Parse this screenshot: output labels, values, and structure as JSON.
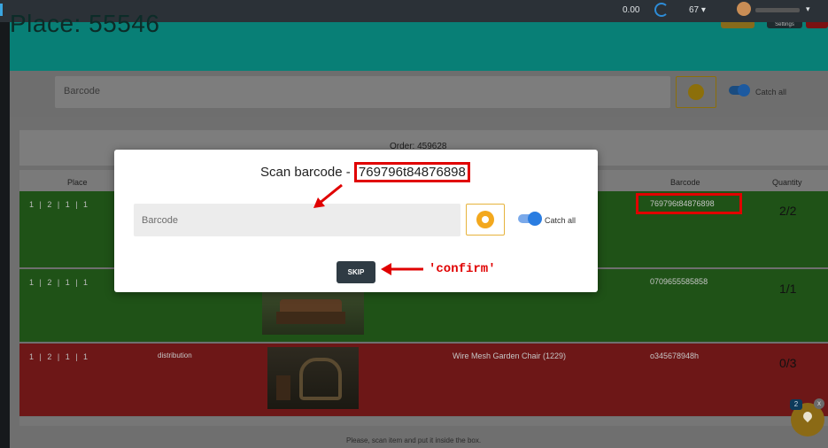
{
  "topbar": {
    "balance": "0.00",
    "count": "67 ▾",
    "user_caret": "▾"
  },
  "header": {
    "title": "Place: 55546",
    "settings_label": "Settings"
  },
  "search": {
    "placeholder": "Barcode",
    "catch_all_label": "Catch all"
  },
  "order": {
    "label": "Order: 459628"
  },
  "table": {
    "columns": {
      "place": "Place",
      "barcode": "Barcode",
      "quantity": "Quantity"
    },
    "rows": [
      {
        "place": "1 | 2 | 1 | 1",
        "type": "",
        "name": "",
        "barcode": "769796t84876898",
        "quantity": "2/2",
        "status_color": "#2e8b25"
      },
      {
        "place": "1 | 2 | 1 | 1",
        "type": "",
        "name": "",
        "barcode": "0709655585858",
        "quantity": "1/1",
        "status_color": "#2e8b25"
      },
      {
        "place": "1 | 2 | 1 | 1",
        "type": "distribution",
        "name": "Wire Mesh Garden Chair (1229)",
        "barcode": "o345678948h",
        "quantity": "0/3",
        "status_color": "#c03030"
      }
    ]
  },
  "footer": {
    "hint": "Please, scan item and put it inside the box."
  },
  "fab": {
    "badge": "2",
    "close": "x"
  },
  "modal": {
    "title_prefix": "Scan barcode - ",
    "barcode": "769796t84876898",
    "input_placeholder": "Barcode",
    "catch_all_label": "Catch all",
    "skip_label": "SKIP"
  },
  "annotations": {
    "confirm_label": "'confirm'",
    "highlight_color": "#e00000"
  },
  "colors": {
    "header": "#0fa89d",
    "success_row": "#2e8b25",
    "error_row": "#c03030",
    "accent_yellow": "#f3a81d",
    "toggle_blue": "#2a7de1"
  }
}
